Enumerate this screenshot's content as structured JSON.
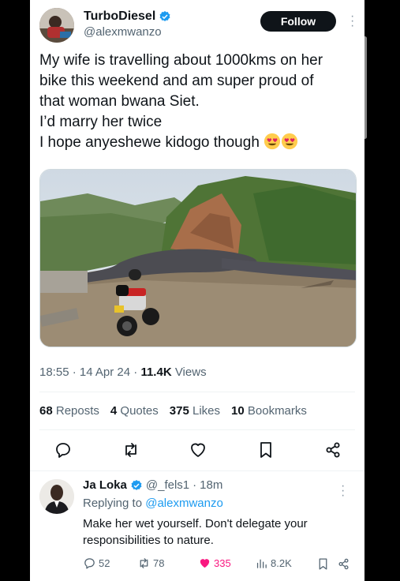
{
  "tweet": {
    "author_name": "TurboDiesel",
    "author_handle": "@alexmwanzo",
    "follow_label": "Follow",
    "text_lines": [
      "My wife is travelling about 1000kms on her",
      "bike this weekend and am super proud of",
      "that woman bwana Siet.",
      "I’d marry her twice",
      "I hope anyeshewe kidogo though"
    ],
    "time": "18:55",
    "date": "14 Apr 24",
    "views_count": "11.4K",
    "views_label": "Views",
    "reposts_count": "68",
    "reposts_label": "Reposts",
    "quotes_count": "4",
    "quotes_label": "Quotes",
    "likes_count": "375",
    "likes_label": "Likes",
    "bookmarks_count": "10",
    "bookmarks_label": "Bookmarks"
  },
  "reply": {
    "author_name": "Ja Loka",
    "author_handle": "@_fels1",
    "age": "18m",
    "replying_prefix": "Replying to",
    "replying_to": "@alexmwanzo",
    "text": "Make her wet yourself. Don't delegate your responsibilities to nature.",
    "replies": "52",
    "reposts": "78",
    "likes": "335",
    "views": "8.2K"
  },
  "icons": {
    "verified": "verified-badge-icon",
    "reply": "reply-icon",
    "repost": "repost-icon",
    "like": "heart-icon",
    "bookmark": "bookmark-icon",
    "share": "share-icon",
    "views": "views-bar-icon",
    "more": "more-icon"
  },
  "colors": {
    "accent": "#1d9bf0",
    "like_active": "#f91880",
    "muted": "#536471",
    "text": "#0f1419"
  }
}
